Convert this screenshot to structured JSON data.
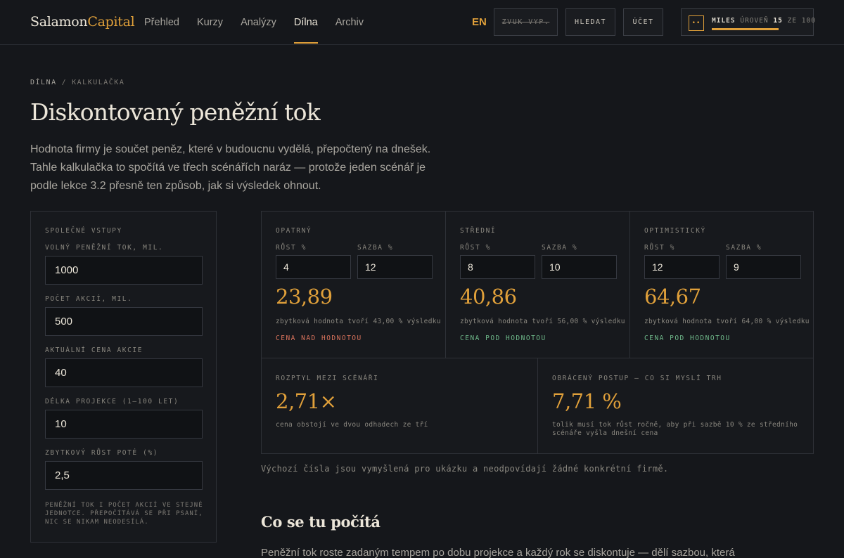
{
  "header": {
    "logo_a": "Salamon",
    "logo_b": "Capital",
    "nav": [
      "Přehled",
      "Kurzy",
      "Analýzy",
      "Dílna",
      "Archiv"
    ],
    "nav_active": "Dílna",
    "lang": "EN",
    "sound_btn": "ZVUK VYP.",
    "search_btn": "HLEDAT",
    "account_btn": "ÚČET",
    "miles": {
      "badge": "••",
      "label": "MILES",
      "level_word": "ÚROVEŇ",
      "level": "15",
      "of_word": "ZE",
      "max": "100",
      "progress": 1.0
    }
  },
  "breadcrumb": {
    "section": "DÍLNA",
    "sep": "/",
    "page": "KALKULAČKA"
  },
  "page_title": "Diskontovaný peněžní tok",
  "lead": "Hodnota firmy je součet peněz, které v budoucnu vydělá, přepočtený na dnešek. Tahle kalkulačka to spočítá ve třech scénářích naráz — protože jeden scénář je podle lekce 3.2 přesně ten způsob, jak si výsledek ohnout.",
  "inputs": {
    "section": "SPOLEČNÉ VSTUPY",
    "fields": [
      {
        "label": "VOLNÝ PENĚŽNÍ TOK, MIL.",
        "value": "1000"
      },
      {
        "label": "POČET AKCIÍ, MIL.",
        "value": "500"
      },
      {
        "label": "AKTUÁLNÍ CENA AKCIE",
        "value": "40"
      },
      {
        "label": "DÉLKA PROJEKCE (1–100 LET)",
        "value": "10"
      },
      {
        "label": "ZBYTKOVÝ RŮST POTÉ (%)",
        "value": "2,5"
      }
    ],
    "note": "PENĚŽNÍ TOK I POČET AKCIÍ VE STEJNÉ JEDNOTCE. PŘEPOČÍTÁVÁ SE PŘI PSANÍ, NIC SE NIKAM NEODESÍLÁ."
  },
  "scenarios": [
    {
      "name": "OPATRNÝ",
      "growth_label": "RŮST %",
      "rate_label": "SAZBA %",
      "growth": "4",
      "rate": "12",
      "value": "23,89",
      "sub": "zbytková hodnota tvoří 43,00 % výsledku",
      "verdict": "CENA NAD HODNOTOU",
      "verdict_color": "#d9735c"
    },
    {
      "name": "STŘEDNÍ",
      "growth_label": "RŮST %",
      "rate_label": "SAZBA %",
      "growth": "8",
      "rate": "10",
      "value": "40,86",
      "sub": "zbytková hodnota tvoří 56,00 % výsledku",
      "verdict": "CENA POD HODNOTOU",
      "verdict_color": "#6fb98a"
    },
    {
      "name": "OPTIMISTICKÝ",
      "growth_label": "RŮST %",
      "rate_label": "SAZBA %",
      "growth": "12",
      "rate": "9",
      "value": "64,67",
      "sub": "zbytková hodnota tvoří 64,00 % výsledku",
      "verdict": "CENA POD HODNOTOU",
      "verdict_color": "#6fb98a"
    }
  ],
  "summary": {
    "spread": {
      "label": "ROZPTYL MEZI SCÉNÁŘI",
      "value": "2,71×",
      "sub": "cena obstojí ve dvou odhadech ze tří"
    },
    "reverse": {
      "label": "OBRÁCENÝ POSTUP — CO SI MYSLÍ TRH",
      "value": "7,71 %",
      "sub": "tolik musí tok růst ročně, aby při sazbě 10 % ze středního scénáře vyšla dnešní cena"
    }
  },
  "disclaimer": "Výchozí čísla jsou vymyšlená pro ukázku a neodpovídají žádné konkrétní firmě.",
  "section_heading": "Co se tu počítá",
  "section_body": "Peněžní tok roste zadaným tempem po dobu projekce a každý rok se diskontuje — dělí sazbou, která",
  "colors": {
    "accent": "#e0a03a",
    "bg": "#15171b",
    "negative": "#d9735c",
    "positive": "#6fb98a"
  }
}
